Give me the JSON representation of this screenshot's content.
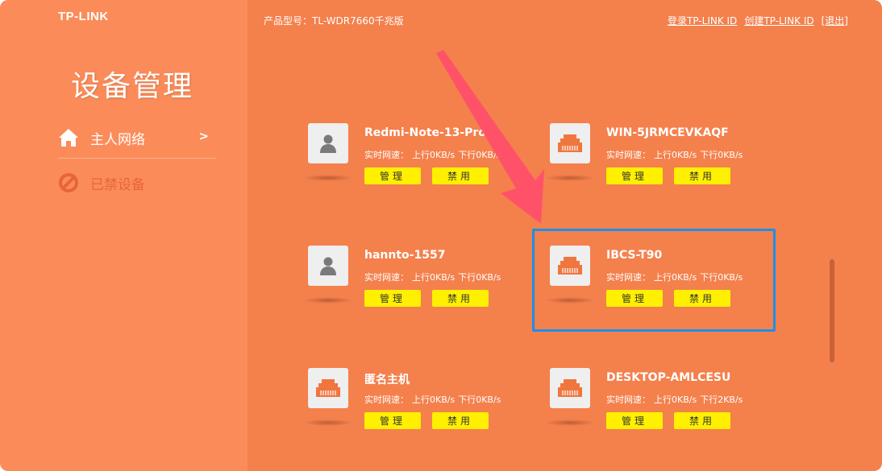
{
  "header": {
    "logo": "TP-LINK",
    "model_label": "产品型号：TL-WDR7660千兆版",
    "links": {
      "login": "登录TP-LINK ID",
      "create": "创建TP-LINK ID",
      "logout": "[退出]"
    }
  },
  "sidebar": {
    "title": "设备管理",
    "items": [
      {
        "label": "主人网络",
        "icon": "home-icon",
        "arrow": ">"
      },
      {
        "label": "已禁设备",
        "icon": "ban-icon"
      }
    ]
  },
  "devices": [
    {
      "name": "Redmi-Note-13-Pro",
      "icon": "person-icon",
      "speed_label": "实时网速：",
      "up": "上行0KB/s",
      "down": "下行0KB/s",
      "manage": "管理",
      "block": "禁用"
    },
    {
      "name": "WIN-5JRMCEVKAQF",
      "icon": "ethernet-icon",
      "speed_label": "实时网速：",
      "up": "上行0KB/s",
      "down": "下行0KB/s",
      "manage": "管理",
      "block": "禁用"
    },
    {
      "name": "hannto-1557",
      "icon": "person-icon",
      "speed_label": "实时网速：",
      "up": "上行0KB/s",
      "down": "下行0KB/s",
      "manage": "管理",
      "block": "禁用"
    },
    {
      "name": "IBCS-T90",
      "icon": "ethernet-icon",
      "speed_label": "实时网速：",
      "up": "上行0KB/s",
      "down": "下行0KB/s",
      "manage": "管理",
      "block": "禁用"
    },
    {
      "name": "匿名主机",
      "icon": "ethernet-icon",
      "speed_label": "实时网速：",
      "up": "上行0KB/s",
      "down": "下行0KB/s",
      "manage": "管理",
      "block": "禁用"
    },
    {
      "name": "DESKTOP-AMLCESU",
      "icon": "ethernet-icon",
      "speed_label": "实时网速：",
      "up": "上行0KB/s",
      "down": "下行2KB/s",
      "manage": "管理",
      "block": "禁用"
    }
  ],
  "colors": {
    "background": "#f4804c",
    "sidebar": "#fb8c59",
    "button": "#fef000",
    "highlight": "#1e8fe8",
    "arrow": "#ff4f6a"
  }
}
